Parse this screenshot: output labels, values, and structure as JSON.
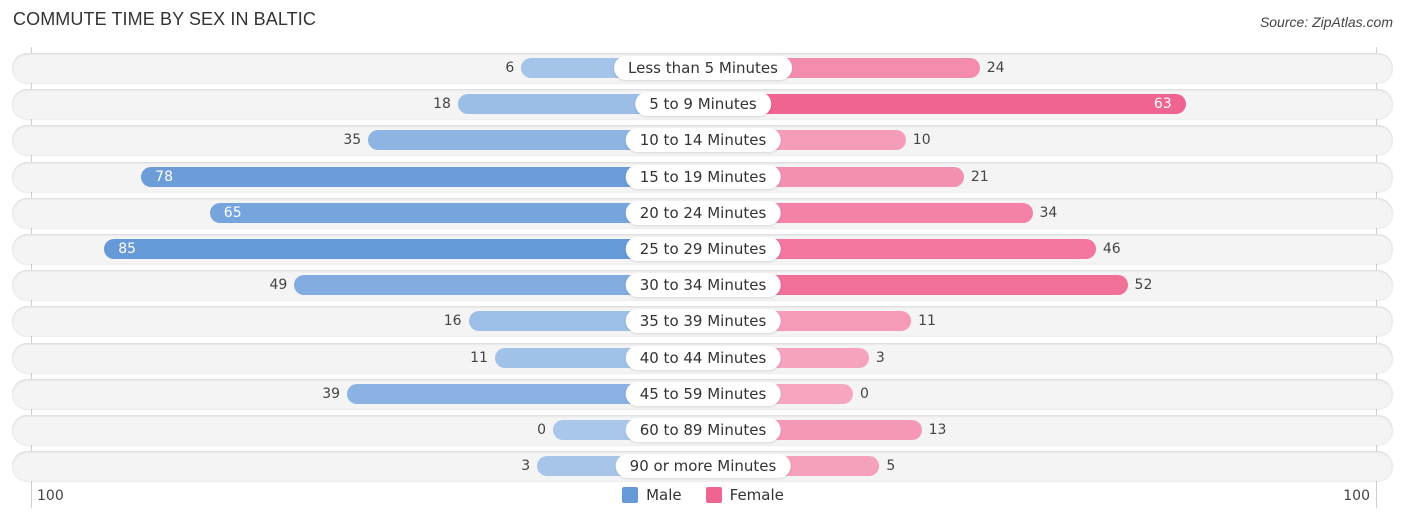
{
  "title": "COMMUTE TIME BY SEX IN BALTIC",
  "source": "Source: ZipAtlas.com",
  "colors": {
    "male_strong": "#6699D8",
    "male_light": "#A9C7EA",
    "female_strong": "#F06490",
    "female_light": "#F6A6BF"
  },
  "chart_data": {
    "type": "bar",
    "orientation": "horizontal-diverging",
    "title": "COMMUTE TIME BY SEX IN BALTIC",
    "categories": [
      "Less than 5 Minutes",
      "5 to 9 Minutes",
      "10 to 14 Minutes",
      "15 to 19 Minutes",
      "20 to 24 Minutes",
      "25 to 29 Minutes",
      "30 to 34 Minutes",
      "35 to 39 Minutes",
      "40 to 44 Minutes",
      "45 to 59 Minutes",
      "60 to 89 Minutes",
      "90 or more Minutes"
    ],
    "series": [
      {
        "name": "Male",
        "side": "left",
        "values": [
          6,
          18,
          35,
          78,
          65,
          85,
          49,
          16,
          11,
          39,
          0,
          3
        ]
      },
      {
        "name": "Female",
        "side": "right",
        "values": [
          24,
          63,
          10,
          21,
          34,
          46,
          52,
          11,
          3,
          0,
          13,
          5
        ]
      }
    ],
    "axis": {
      "left_tick": "100",
      "right_tick": "100",
      "range": [
        0,
        100
      ]
    },
    "legend": {
      "position": "bottom-center",
      "items": [
        "Male",
        "Female"
      ]
    },
    "grid": false
  }
}
